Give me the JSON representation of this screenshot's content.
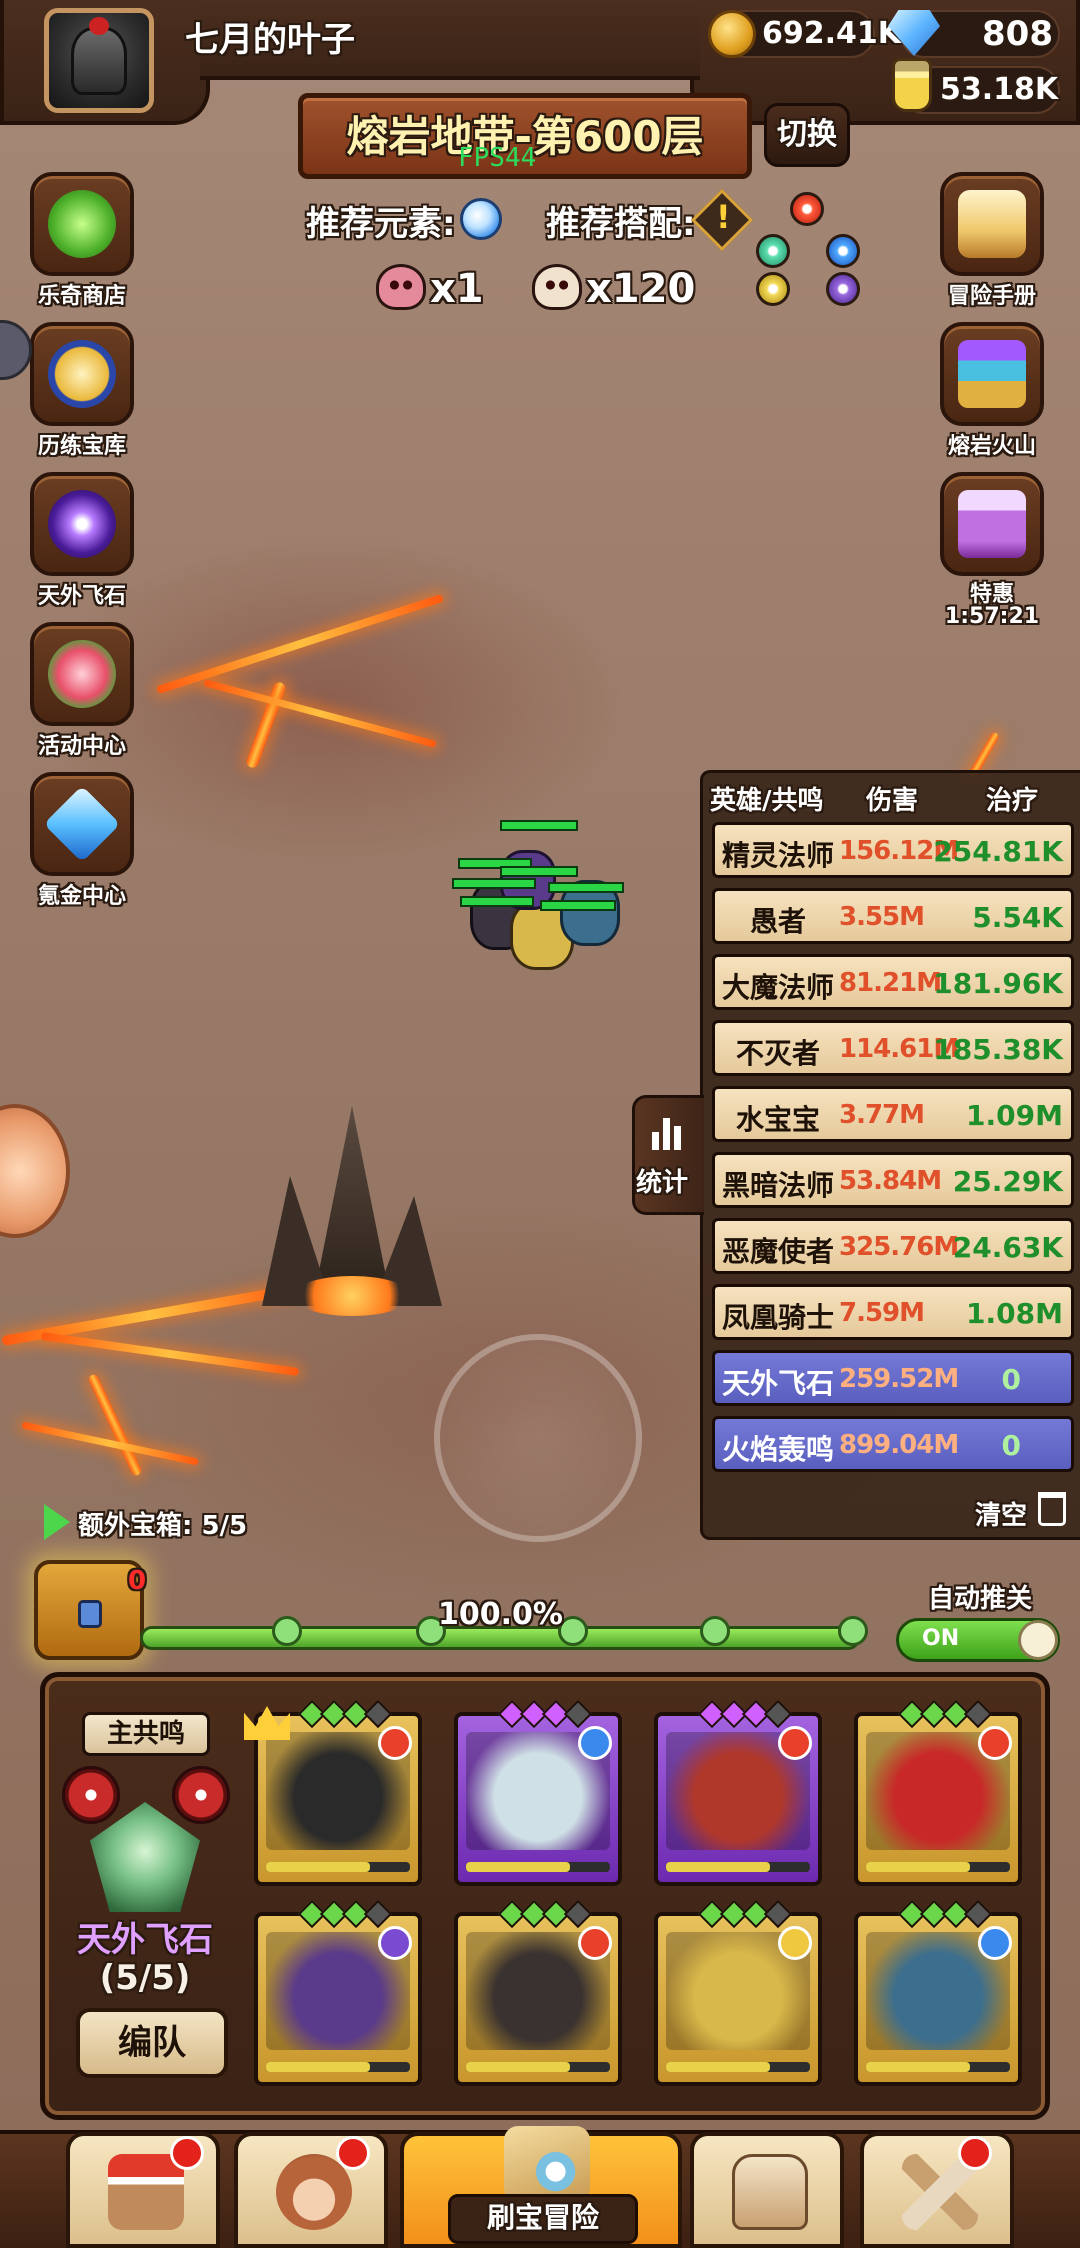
{
  "player": {
    "name": "七月的叶子"
  },
  "resources": {
    "gold": "692.41K",
    "gems": "808",
    "potion": "53.18K"
  },
  "stage": {
    "title": "熔岩地带-第600层",
    "fps": "FPS44",
    "switch_label": "切换"
  },
  "recommend": {
    "element_label": "推荐元素:",
    "combo_label": "推荐搭配:"
  },
  "enemies": {
    "boss_count": "x1",
    "minion_count": "x120"
  },
  "left_menu": [
    {
      "label": "乐奇商店",
      "icon": "clover-icon"
    },
    {
      "label": "历练宝库",
      "icon": "trophy-icon"
    },
    {
      "label": "天外飞石",
      "icon": "vortex-icon"
    },
    {
      "label": "活动中心",
      "icon": "bouquet-icon"
    },
    {
      "label": "氪金中心",
      "icon": "diamond-icon"
    }
  ],
  "right_menu": [
    {
      "label": "冒险手册",
      "icon": "scroll-icon"
    },
    {
      "label": "熔岩火山",
      "icon": "treasure-chest-icon"
    },
    {
      "label": "特惠",
      "icon": "gift-box-icon",
      "timer": "1:57:21"
    }
  ],
  "stats": {
    "headers": {
      "hero": "英雄/共鸣",
      "damage": "伤害",
      "heal": "治疗"
    },
    "rows": [
      {
        "name": "精灵法师",
        "damage": "156.12M",
        "heal": "254.81K",
        "kind": "hero"
      },
      {
        "name": "愚者",
        "damage": "3.55M",
        "heal": "5.54K",
        "kind": "hero"
      },
      {
        "name": "大魔法师",
        "damage": "81.21M",
        "heal": "181.96K",
        "kind": "hero"
      },
      {
        "name": "不灭者",
        "damage": "114.61M",
        "heal": "185.38K",
        "kind": "hero"
      },
      {
        "name": "水宝宝",
        "damage": "3.77M",
        "heal": "1.09M",
        "kind": "hero"
      },
      {
        "name": "黑暗法师",
        "damage": "53.84M",
        "heal": "25.29K",
        "kind": "hero"
      },
      {
        "name": "恶魔使者",
        "damage": "325.76M",
        "heal": "24.63K",
        "kind": "hero"
      },
      {
        "name": "凤凰骑士",
        "damage": "7.59M",
        "heal": "1.08M",
        "kind": "hero"
      },
      {
        "name": "天外飞石",
        "damage": "259.52M",
        "heal": "0",
        "kind": "resonance"
      },
      {
        "name": "火焰轰鸣",
        "damage": "899.04M",
        "heal": "0",
        "kind": "resonance"
      }
    ],
    "clear_label": "清空",
    "tab_label": "统计"
  },
  "progress": {
    "extra_chest_label": "额外宝箱: 5/5",
    "chest_badge": "0",
    "percent_text": "100.0%",
    "percent": 100,
    "auto_label": "自动推关",
    "auto_state": "ON"
  },
  "team": {
    "main_resonance_label": "主共鸣",
    "resonance_name": "天外飞石",
    "resonance_count": "(5/5)",
    "formation_label": "编队",
    "heroes": [
      {
        "frame": "gold",
        "element": "fire",
        "portrait": "#2a2a2a"
      },
      {
        "frame": "purple",
        "element": "water",
        "portrait": "#cfe0e6"
      },
      {
        "frame": "purple",
        "element": "fire",
        "portrait": "#b0382a"
      },
      {
        "frame": "gold",
        "element": "fire",
        "portrait": "#c82828"
      },
      {
        "frame": "gold",
        "element": "dark",
        "portrait": "#5a3a8a"
      },
      {
        "frame": "gold",
        "element": "fire",
        "portrait": "#3a3230"
      },
      {
        "frame": "gold",
        "element": "light",
        "portrait": "#d8b84a"
      },
      {
        "frame": "gold",
        "element": "water",
        "portrait": "#3c6e8e"
      }
    ]
  },
  "bottom_nav": {
    "adventure_label": "刷宝冒险"
  },
  "colors": {
    "damage": "#e0502a",
    "heal": "#1f8f2c",
    "resonance_row": "#5a5fbf",
    "accent": "#ffc33a"
  }
}
